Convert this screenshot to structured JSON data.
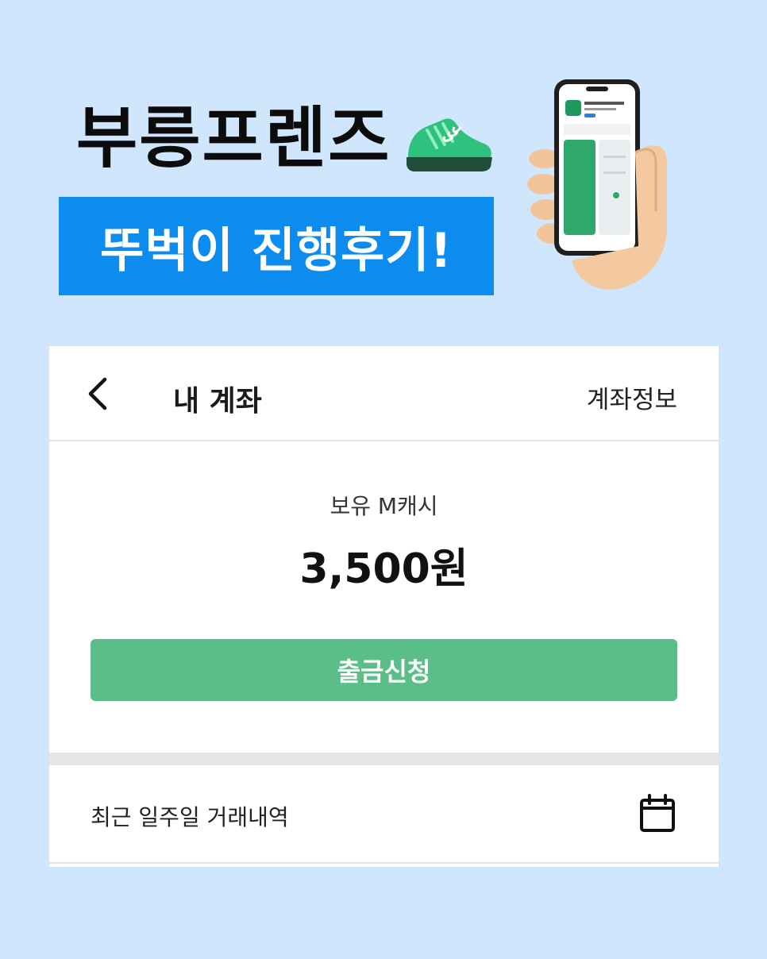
{
  "promo": {
    "title": "부릉프렌즈",
    "banner": "뚜벅이 진행후기!",
    "shoe_icon": "sneaker-icon",
    "phone_icon": "hand-holding-phone-icon",
    "brand_green": "#2ec27e",
    "banner_color": "#0d8cf0",
    "background_color": "#cfe6fc"
  },
  "account": {
    "back_icon": "chevron-left-icon",
    "title": "내 계좌",
    "info_link": "계좌정보",
    "balance_label": "보유 M캐시",
    "balance_amount": "3,500원",
    "withdraw_button": "출금신청",
    "button_color": "#5bbd88",
    "history_label": "최근 일주일 거래내역",
    "calendar_icon": "calendar-icon"
  }
}
